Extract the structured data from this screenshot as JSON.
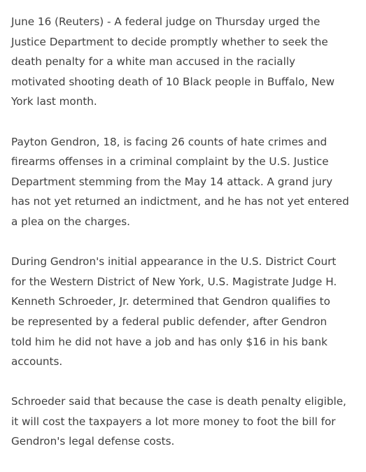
{
  "article": {
    "paragraphs": [
      [
        "June 16 (Reuters) - A federal judge on Thursday urged the",
        "Justice Department to decide promptly whether to seek the",
        "death penalty for a white man accused in the racially",
        "motivated shooting death of 10 Black people in Buffalo, New",
        "York last month."
      ],
      [
        "Payton Gendron, 18, is facing 26 counts of hate crimes and",
        "firearms offenses in a criminal complaint by the U.S. Justice",
        "Department stemming from the May 14 attack. A grand jury",
        "has not yet returned an indictment, and he has not yet entered",
        "a plea on the charges."
      ],
      [
        "During Gendron's initial appearance in the U.S. District Court",
        "for the Western District of New York, U.S. Magistrate Judge H.",
        "Kenneth Schroeder, Jr. determined that Gendron qualifies to",
        "be represented by a federal public defender, after Gendron",
        "told him he did not have a job and has only $16 in his bank",
        "accounts."
      ],
      [
        "Schroeder said that because the case is death penalty eligible,",
        "it will cost the taxpayers a lot more money to foot the bill for",
        "Gendron's legal defense costs."
      ]
    ]
  }
}
